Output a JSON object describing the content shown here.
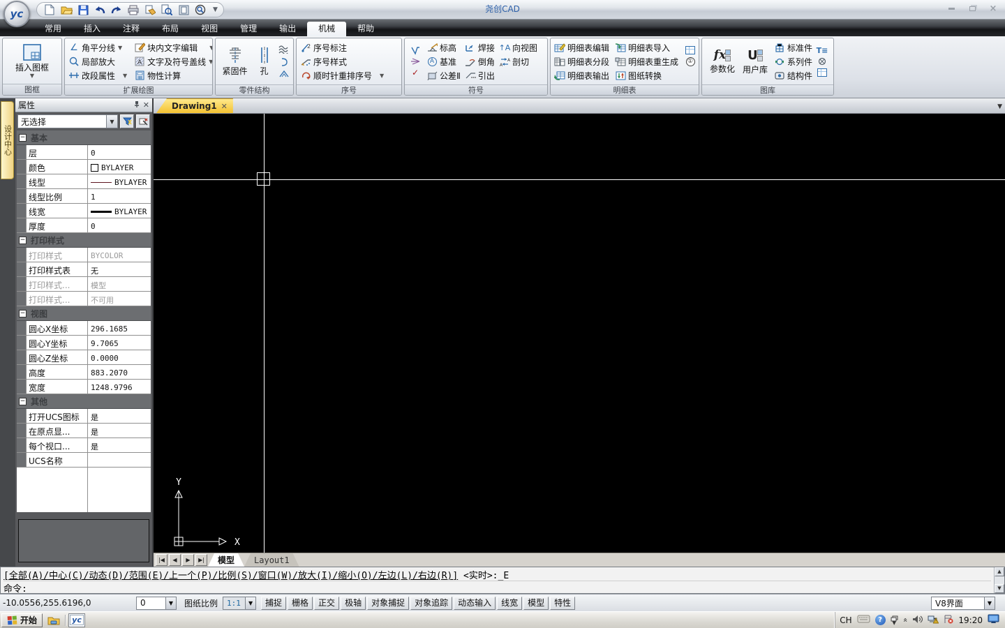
{
  "window": {
    "title": "尧创CAD"
  },
  "quick_access_icons": [
    "new-file",
    "open-file",
    "save",
    "undo",
    "redo",
    "print",
    "publish",
    "find",
    "preview",
    "zoom"
  ],
  "menu_tabs": [
    {
      "label": "常用",
      "active": false
    },
    {
      "label": "插入",
      "active": false
    },
    {
      "label": "注释",
      "active": false
    },
    {
      "label": "布局",
      "active": false
    },
    {
      "label": "视图",
      "active": false
    },
    {
      "label": "管理",
      "active": false
    },
    {
      "label": "输出",
      "active": false
    },
    {
      "label": "机械",
      "active": true
    },
    {
      "label": "帮助",
      "active": false
    }
  ],
  "ribbon": {
    "frame": {
      "title": "图框",
      "insert": "插入图框"
    },
    "extend": {
      "title": "扩展绘图",
      "bisector": "角平分线",
      "detail": "局部放大",
      "segment": "改段属性",
      "blocktext": "块内文字编辑",
      "coverline": "文字及符号盖线",
      "calc": "物性计算"
    },
    "part": {
      "title": "零件结构",
      "fastener": "紧固件",
      "hole": "孔"
    },
    "seq": {
      "title": "序号",
      "mark": "序号标注",
      "style": "序号样式",
      "rearrange": "顺时针重排序号"
    },
    "symbol": {
      "title": "符号",
      "elev": "标高",
      "weld": "焊接",
      "view": "向视图",
      "datum": "基准",
      "chamfer": "倒角",
      "section": "剖切",
      "tol": "公差Ⅱ",
      "leader": "引出"
    },
    "bom": {
      "title": "明细表",
      "edit": "明细表编辑",
      "import": "明细表导入",
      "split": "明细表分段",
      "regen": "明细表重生成",
      "export": "明细表输出",
      "convert": "图纸转换"
    },
    "library": {
      "title": "图库",
      "param": "参数化",
      "userlib": "用户库",
      "standard": "标准件",
      "series": "系列件",
      "struct": "结构件"
    }
  },
  "side_tab": {
    "label": "设计中心"
  },
  "properties": {
    "title": "属性",
    "selector": "无选择",
    "sections": [
      {
        "title": "基本",
        "rows": [
          {
            "label": "层",
            "value": "0",
            "kind": "plain",
            "disabled": false
          },
          {
            "label": "颜色",
            "value": "BYLAYER",
            "kind": "swatch",
            "disabled": false
          },
          {
            "label": "线型",
            "value": "BYLAYER",
            "kind": "linetype",
            "disabled": false
          },
          {
            "label": "线型比例",
            "value": "1",
            "kind": "plain",
            "disabled": false
          },
          {
            "label": "线宽",
            "value": "BYLAYER",
            "kind": "lineweight",
            "disabled": false
          },
          {
            "label": "厚度",
            "value": "0",
            "kind": "plain",
            "disabled": false
          }
        ]
      },
      {
        "title": "打印样式",
        "rows": [
          {
            "label": "打印样式",
            "value": "BYCOLOR",
            "kind": "plain",
            "disabled": true
          },
          {
            "label": "打印样式表",
            "value": "无",
            "kind": "plain",
            "disabled": false
          },
          {
            "label": "打印样式...",
            "value": "模型",
            "kind": "plain",
            "disabled": true
          },
          {
            "label": "打印样式...",
            "value": "不可用",
            "kind": "plain",
            "disabled": true
          }
        ]
      },
      {
        "title": "视图",
        "rows": [
          {
            "label": "圆心X坐标",
            "value": "296.1685",
            "kind": "plain",
            "disabled": false
          },
          {
            "label": "圆心Y坐标",
            "value": "9.7065",
            "kind": "plain",
            "disabled": false
          },
          {
            "label": "圆心Z坐标",
            "value": "0.0000",
            "kind": "plain",
            "disabled": false
          },
          {
            "label": "高度",
            "value": "883.2070",
            "kind": "plain",
            "disabled": false
          },
          {
            "label": "宽度",
            "value": "1248.9796",
            "kind": "plain",
            "disabled": false
          }
        ]
      },
      {
        "title": "其他",
        "rows": [
          {
            "label": "打开UCS图标",
            "value": "是",
            "kind": "plain",
            "disabled": false
          },
          {
            "label": "在原点显...",
            "value": "是",
            "kind": "plain",
            "disabled": false
          },
          {
            "label": "每个视口...",
            "value": "是",
            "kind": "plain",
            "disabled": false
          },
          {
            "label": "UCS名称",
            "value": "",
            "kind": "plain",
            "disabled": false
          }
        ]
      }
    ]
  },
  "drawing": {
    "doc_tab": "Drawing1",
    "model_tab": "模型",
    "layout_tab": "Layout1",
    "ucs_x": "X",
    "ucs_y": "Y"
  },
  "command": {
    "options": "[全部(A)/中心(C)/动态(D)/范围(E)/上一个(P)/比例(S)/窗口(W)/放大(I)/缩小(O)/左边(L)/右边(R)]",
    "tail": " <实时>:_E",
    "prompt": "命令:"
  },
  "status_bar": {
    "coords": "-10.0556,255.6196,0",
    "layer": "0",
    "scale_label": "图纸比例",
    "scale": "1:1",
    "toggles": [
      "捕捉",
      "栅格",
      "正交",
      "极轴",
      "对象捕捉",
      "对象追踪",
      "动态输入",
      "线宽",
      "模型",
      "特性"
    ],
    "ui_scheme": "V8界面"
  },
  "taskbar": {
    "start": "开始",
    "lang": "CH",
    "time": "19:20"
  },
  "colors": {
    "canvas": "#000000",
    "doc_tab_yellow": "#f3c131",
    "title_text": "#2b5ea7",
    "crosshair": "#ffffff"
  }
}
